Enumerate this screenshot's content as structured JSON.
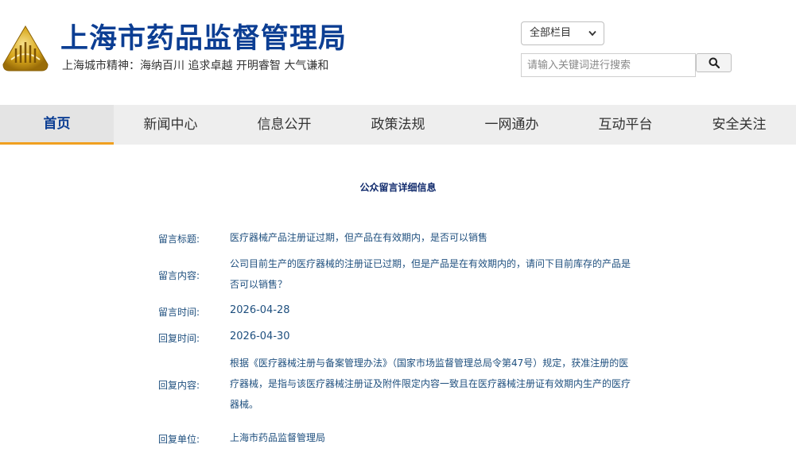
{
  "header": {
    "site_title": "上海市药品监督管理局",
    "slogan": "上海城市精神：海纳百川  追求卓越  开明睿智  大气谦和",
    "logo_icon": "shanghai-emblem-logo",
    "brand_color": "#0c3e93",
    "accent_color": "#d9a81c"
  },
  "search": {
    "scope_selected": "全部栏目",
    "placeholder": "请输入关键词进行搜索",
    "button_icon": "search-icon"
  },
  "nav": {
    "items": [
      {
        "label": "首页"
      },
      {
        "label": "新闻中心"
      },
      {
        "label": "信息公开"
      },
      {
        "label": "政策法规"
      },
      {
        "label": "一网通办"
      },
      {
        "label": "互动平台"
      },
      {
        "label": "安全关注"
      }
    ],
    "active_index": 0,
    "active_underline_color": "#f0a020"
  },
  "detail": {
    "title": "公众留言详细信息",
    "fields": [
      {
        "label": "留言标题:",
        "value": "医疗器械产品注册证过期，但产品在有效期内，是否可以销售"
      },
      {
        "label": "留言内容:",
        "value": "公司目前生产的医疗器械的注册证已过期，但是产品是在有效期内的，请问下目前库存的产品是否可以销售？"
      },
      {
        "label": "留言时间:",
        "value": "2026-04-28"
      },
      {
        "label": "回复时间:",
        "value": "2026-04-30"
      },
      {
        "label": "回复内容:",
        "value": "根据《医疗器械注册与备案管理办法》（国家市场监督管理总局令第47号）规定，获准注册的医疗器械，是指与该医疗器械注册证及附件限定内容一致且在医疗器械注册证有效期内生产的医疗器械。"
      },
      {
        "label": "回复单位:",
        "value": "上海市药品监督管理局"
      }
    ]
  }
}
